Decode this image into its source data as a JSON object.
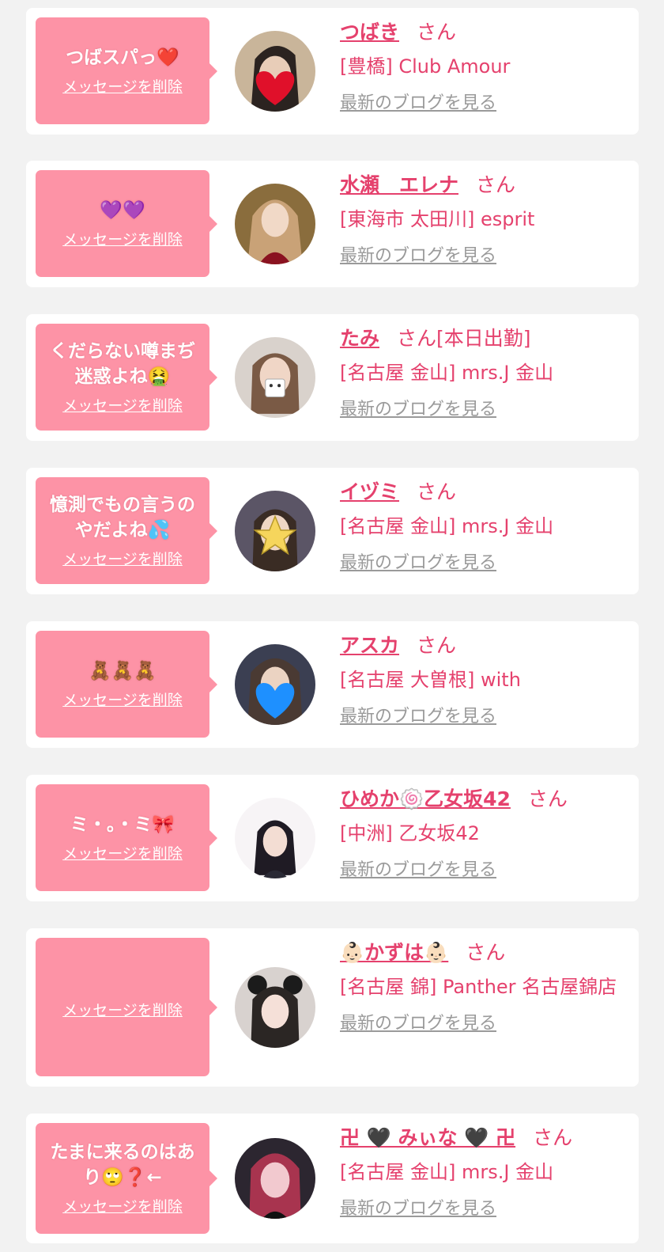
{
  "messages": [
    {
      "text": "つばスパっ❤️",
      "delete_label": "メッセージを削除",
      "name": "つばき",
      "honorific": "さん",
      "status": "",
      "shop": "[豊橋] Club Amour",
      "blog_label": "最新のブログを見る",
      "avatar_icon": "heart-sticker"
    },
    {
      "text": "💜💜",
      "delete_label": "メッセージを削除",
      "name": "水瀬　エレナ",
      "honorific": "さん",
      "status": "",
      "shop": "[東海市 太田川] esprit",
      "blog_label": "最新のブログを見る",
      "avatar_icon": "portrait"
    },
    {
      "text": "くだらない噂まぢ迷惑よね🤮",
      "delete_label": "メッセージを削除",
      "name": "たみ",
      "honorific": "さん",
      "status": "[本日出勤]",
      "shop": "[名古屋 金山] mrs.J 金山",
      "blog_label": "最新のブログを見る",
      "avatar_icon": "box-sticker"
    },
    {
      "text": "憶測でもの言うのやだよね💦",
      "delete_label": "メッセージを削除",
      "name": "イヅミ",
      "honorific": "さん",
      "status": "",
      "shop": "[名古屋 金山] mrs.J 金山",
      "blog_label": "最新のブログを見る",
      "avatar_icon": "star-sticker"
    },
    {
      "text": "🧸🧸🧸",
      "delete_label": "メッセージを削除",
      "name": "アスカ",
      "honorific": "さん",
      "status": "",
      "shop": "[名古屋 大曽根] with",
      "blog_label": "最新のブログを見る",
      "avatar_icon": "blue-heart-sticker"
    },
    {
      "text": "ミ・。・ミ🎀",
      "delete_label": "メッセージを削除",
      "name": "ひめか🍥乙女坂42",
      "honorific": "さん",
      "status": "",
      "shop": "[中洲] 乙女坂42",
      "blog_label": "最新のブログを見る",
      "avatar_icon": "portrait"
    },
    {
      "text": "",
      "delete_label": "メッセージを削除",
      "name": "👶🏻かずは👶🏻",
      "honorific": "さん",
      "status": "",
      "shop": "[名古屋 錦] Panther 名古屋錦店",
      "blog_label": "最新のブログを見る",
      "avatar_icon": "portrait"
    },
    {
      "text": "たまに来るのはあり🙄❓←",
      "delete_label": "メッセージを削除",
      "name": "卍 🖤 みぃな 🖤 卍",
      "honorific": "さん",
      "status": "",
      "shop": "[名古屋 金山] mrs.J 金山",
      "blog_label": "最新のブログを見る",
      "avatar_icon": "portrait"
    }
  ],
  "colors": {
    "background": "#f2f2f2",
    "card": "#ffffff",
    "bubble": "#fd93a6",
    "name_accent": "#e5416d",
    "blog_link": "#9a9a9a"
  }
}
